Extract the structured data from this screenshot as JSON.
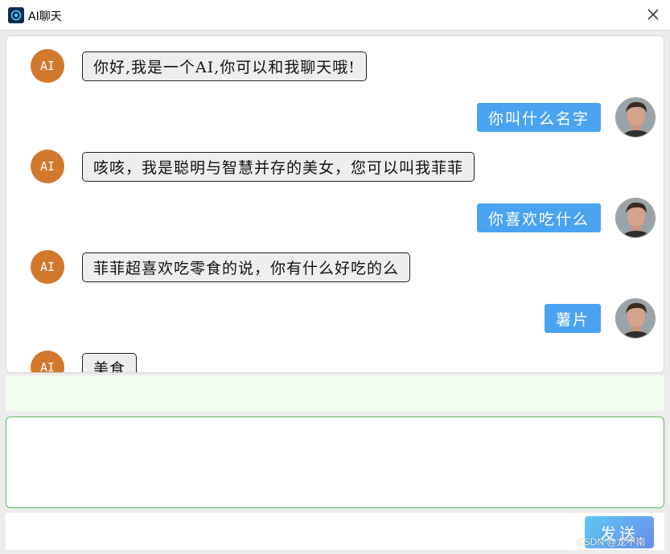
{
  "window": {
    "title": "AI聊天",
    "icon": "chat-logo-icon",
    "close_glyph": "✕"
  },
  "chat": {
    "ai_avatar_label": "AI",
    "ai_color": "#d2782d",
    "user_bubble_color": "#4aa3f0",
    "messages": [
      {
        "role": "ai",
        "text": "你好,我是一个AI,你可以和我聊天哦!"
      },
      {
        "role": "user",
        "text": "你叫什么名字"
      },
      {
        "role": "ai",
        "text": "咳咳，我是聪明与智慧并存的美女，您可以叫我菲菲"
      },
      {
        "role": "user",
        "text": "你喜欢吃什么"
      },
      {
        "role": "ai",
        "text": "菲菲超喜欢吃零食的说，你有什么好吃的么"
      },
      {
        "role": "user",
        "text": "薯片"
      },
      {
        "role": "ai",
        "text": "美食"
      }
    ]
  },
  "input": {
    "value": "",
    "placeholder": ""
  },
  "send_button": {
    "label": "发送"
  },
  "watermark": "CSDN @龙不南"
}
